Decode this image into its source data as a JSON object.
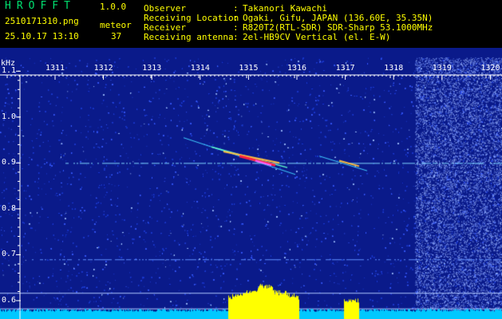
{
  "header": {
    "app_title": "HROFFT",
    "app_version": "1.0.0",
    "filename": "2510171310.png",
    "timestamp": "25.10.17 13:10",
    "meteor_label": "meteor",
    "meteor_count": "37",
    "info": [
      {
        "label": "Observer",
        "value": "Takanori Kawachi"
      },
      {
        "label": "Receiving Location",
        "value": "Ogaki, Gifu, JAPAN (136.60E, 35.35N)"
      },
      {
        "label": "Receiver",
        "value": "R820T2(RTL-SDR) SDR-Sharp 53.1000MHz"
      },
      {
        "label": "Receiving antenna",
        "value": "2el-HB9CV Vertical (el. E-W)"
      }
    ]
  },
  "spectrogram": {
    "y_unit": "kHz",
    "x_ticks": [
      "1311",
      "1312",
      "1313",
      "1314",
      "1315",
      "1316",
      "1317",
      "1318",
      "1319",
      "1320"
    ],
    "y_ticks": [
      "1.1",
      "1.0",
      "0.9",
      "0.8",
      "0.7",
      "0.6"
    ],
    "colors": {
      "background": "#0a1a8a",
      "noise": "#3a5cff",
      "carrier": "#7fd8ff",
      "echo": "#ff2040",
      "level_baseline": "#00c8ff",
      "level_peak": "#ffff00",
      "ref_lines": "#b0c8ff"
    }
  }
}
